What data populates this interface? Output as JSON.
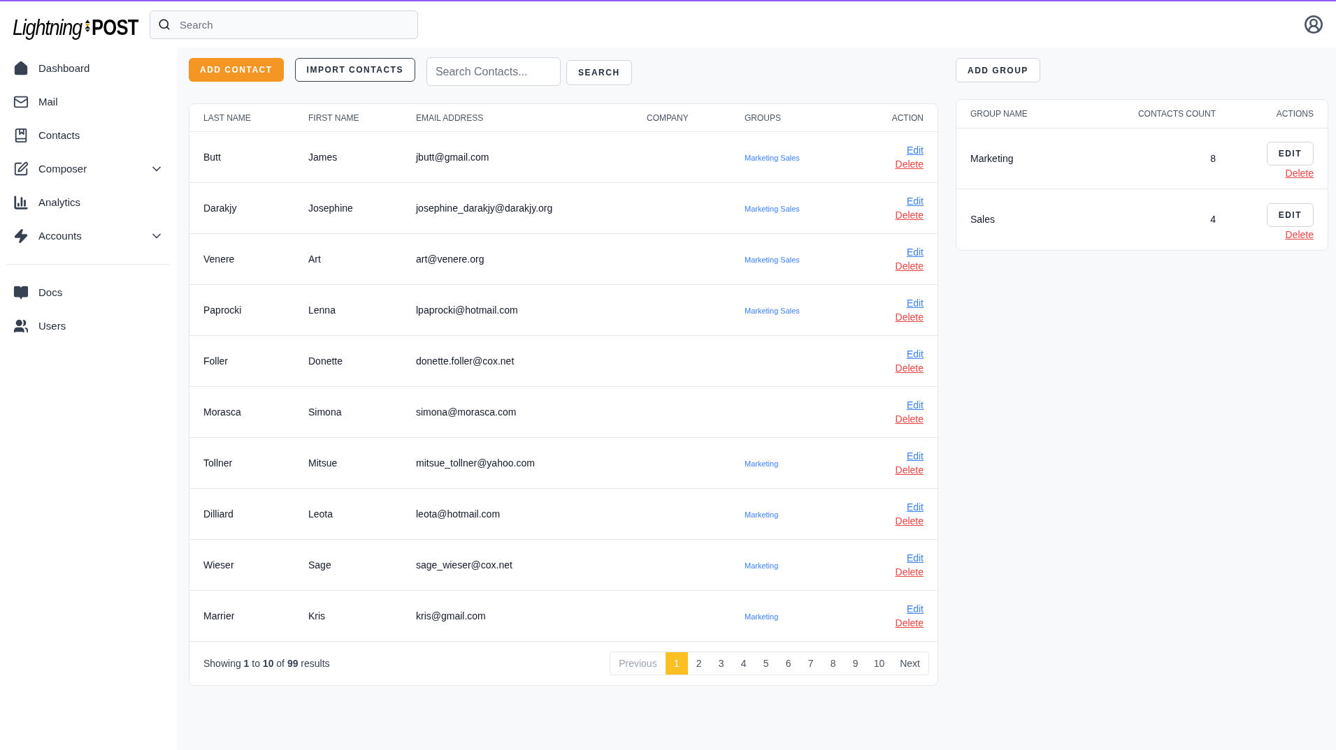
{
  "logo": {
    "left": "Lightning",
    "right": "POST"
  },
  "header": {
    "search": {
      "placeholder": "Search"
    }
  },
  "sidebar": {
    "items": [
      {
        "label": "Dashboard",
        "expandable": false
      },
      {
        "label": "Mail",
        "expandable": false
      },
      {
        "label": "Contacts",
        "expandable": false
      },
      {
        "label": "Composer",
        "expandable": true
      },
      {
        "label": "Analytics",
        "expandable": false
      },
      {
        "label": "Accounts",
        "expandable": true
      }
    ],
    "bottom_items": [
      {
        "label": "Docs"
      },
      {
        "label": "Users"
      }
    ]
  },
  "toolbar": {
    "add_contact": "ADD CONTACT",
    "import_contacts": "IMPORT CONTACTS",
    "search": {
      "placeholder": "Search Contacts..."
    },
    "search_button": "SEARCH"
  },
  "contacts_table": {
    "columns": [
      "LAST NAME",
      "FIRST NAME",
      "EMAIL ADDRESS",
      "COMPANY",
      "GROUPS",
      "ACTION"
    ],
    "rows": [
      {
        "last_name": "Butt",
        "first_name": "James",
        "email": "jbutt@gmail.com",
        "groups": "Marketing Sales",
        "edit": "Edit",
        "delete": "Delete"
      },
      {
        "last_name": "Darakjy",
        "first_name": "Josephine",
        "email": "josephine_darakjy@darakjy.org",
        "groups": "Marketing Sales",
        "edit": "Edit",
        "delete": "Delete"
      },
      {
        "last_name": "Venere",
        "first_name": "Art",
        "email": "art@venere.org",
        "groups": "Marketing Sales",
        "edit": "Edit",
        "delete": "Delete"
      },
      {
        "last_name": "Paprocki",
        "first_name": "Lenna",
        "email": "lpaprocki@hotmail.com",
        "groups": "Marketing Sales",
        "edit": "Edit",
        "delete": "Delete"
      },
      {
        "last_name": "Foller",
        "first_name": "Donette",
        "email": "donette.foller@cox.net",
        "edit": "Edit",
        "delete": "Delete"
      },
      {
        "last_name": "Morasca",
        "first_name": "Simona",
        "email": "simona@morasca.com",
        "edit": "Edit",
        "delete": "Delete"
      },
      {
        "last_name": "Tollner",
        "first_name": "Mitsue",
        "email": "mitsue_tollner@yahoo.com",
        "groups": "Marketing",
        "edit": "Edit",
        "delete": "Delete"
      },
      {
        "last_name": "Dilliard",
        "first_name": "Leota",
        "email": "leota@hotmail.com",
        "groups": "Marketing",
        "edit": "Edit",
        "delete": "Delete"
      },
      {
        "last_name": "Wieser",
        "first_name": "Sage",
        "email": "sage_wieser@cox.net",
        "groups": "Marketing",
        "edit": "Edit",
        "delete": "Delete"
      },
      {
        "last_name": "Marrier",
        "first_name": "Kris",
        "email": "kris@gmail.com",
        "groups": "Marketing",
        "edit": "Edit",
        "delete": "Delete"
      }
    ],
    "summary": "Showing **1** to **10** of **99** results",
    "pagination": {
      "previous": {
        "label": "Previous",
        "disabled": true
      },
      "pages": [
        {
          "label": "1",
          "selected": true
        },
        {
          "label": "2",
          "selected": false
        },
        {
          "label": "3",
          "selected": false
        },
        {
          "label": "4",
          "selected": false
        },
        {
          "label": "5",
          "selected": false
        },
        {
          "label": "6",
          "selected": false
        },
        {
          "label": "7",
          "selected": false
        },
        {
          "label": "8",
          "selected": false
        },
        {
          "label": "9",
          "selected": false
        },
        {
          "label": "10",
          "selected": false
        }
      ],
      "next": {
        "label": "Next",
        "disabled": false
      }
    }
  },
  "groups_panel": {
    "add_group": "ADD GROUP",
    "columns": [
      "GROUP NAME",
      "CONTACTS COUNT",
      "ACTIONS"
    ],
    "rows": [
      {
        "name": "Marketing",
        "count": "8",
        "edit": "EDIT",
        "delete": "Delete"
      },
      {
        "name": "Sales",
        "count": "4",
        "edit": "EDIT",
        "delete": "Delete"
      }
    ]
  }
}
